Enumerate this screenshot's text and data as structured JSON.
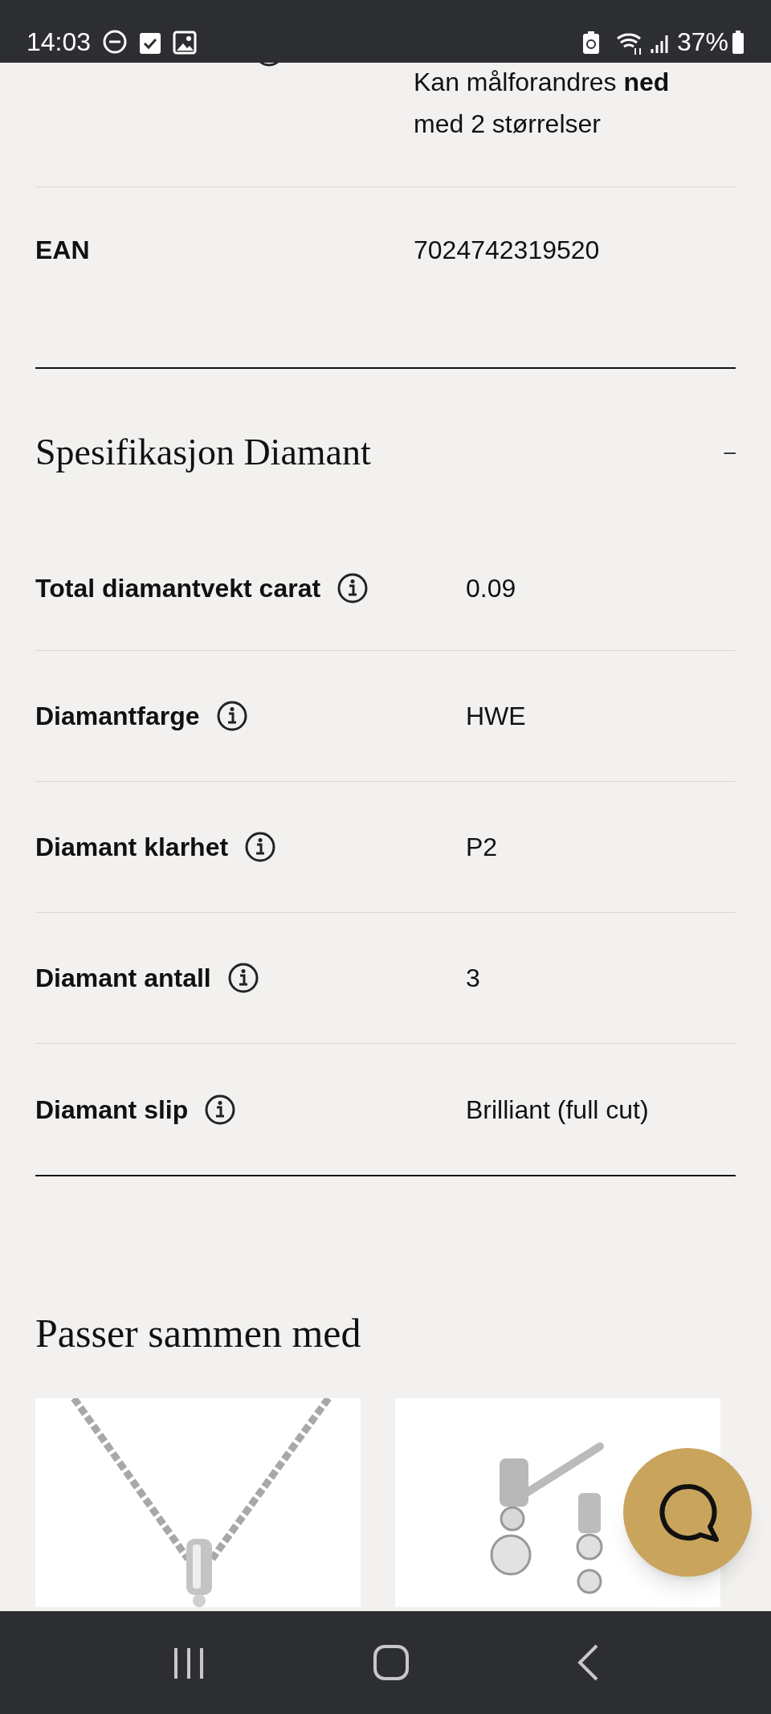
{
  "status_bar": {
    "time": "14:03",
    "battery": "37%"
  },
  "size_row": {
    "value": "Kan målforandres **ned** med 2 størrelser"
  },
  "ean_row": {
    "label": "EAN",
    "value": "7024742319520"
  },
  "diamond_section": {
    "title": "Spesifikasjon Diamant",
    "toggle": "–",
    "expanded": true,
    "rows": [
      {
        "label": "Total diamantvekt carat",
        "value": "0.09"
      },
      {
        "label": "Diamantfarge",
        "value": "HWE"
      },
      {
        "label": "Diamant klarhet",
        "value": "P2"
      },
      {
        "label": "Diamant antall",
        "value": "3"
      },
      {
        "label": "Diamant slip",
        "value": "Brilliant (full cut)"
      }
    ]
  },
  "related": {
    "title": "Passer sammen med"
  }
}
